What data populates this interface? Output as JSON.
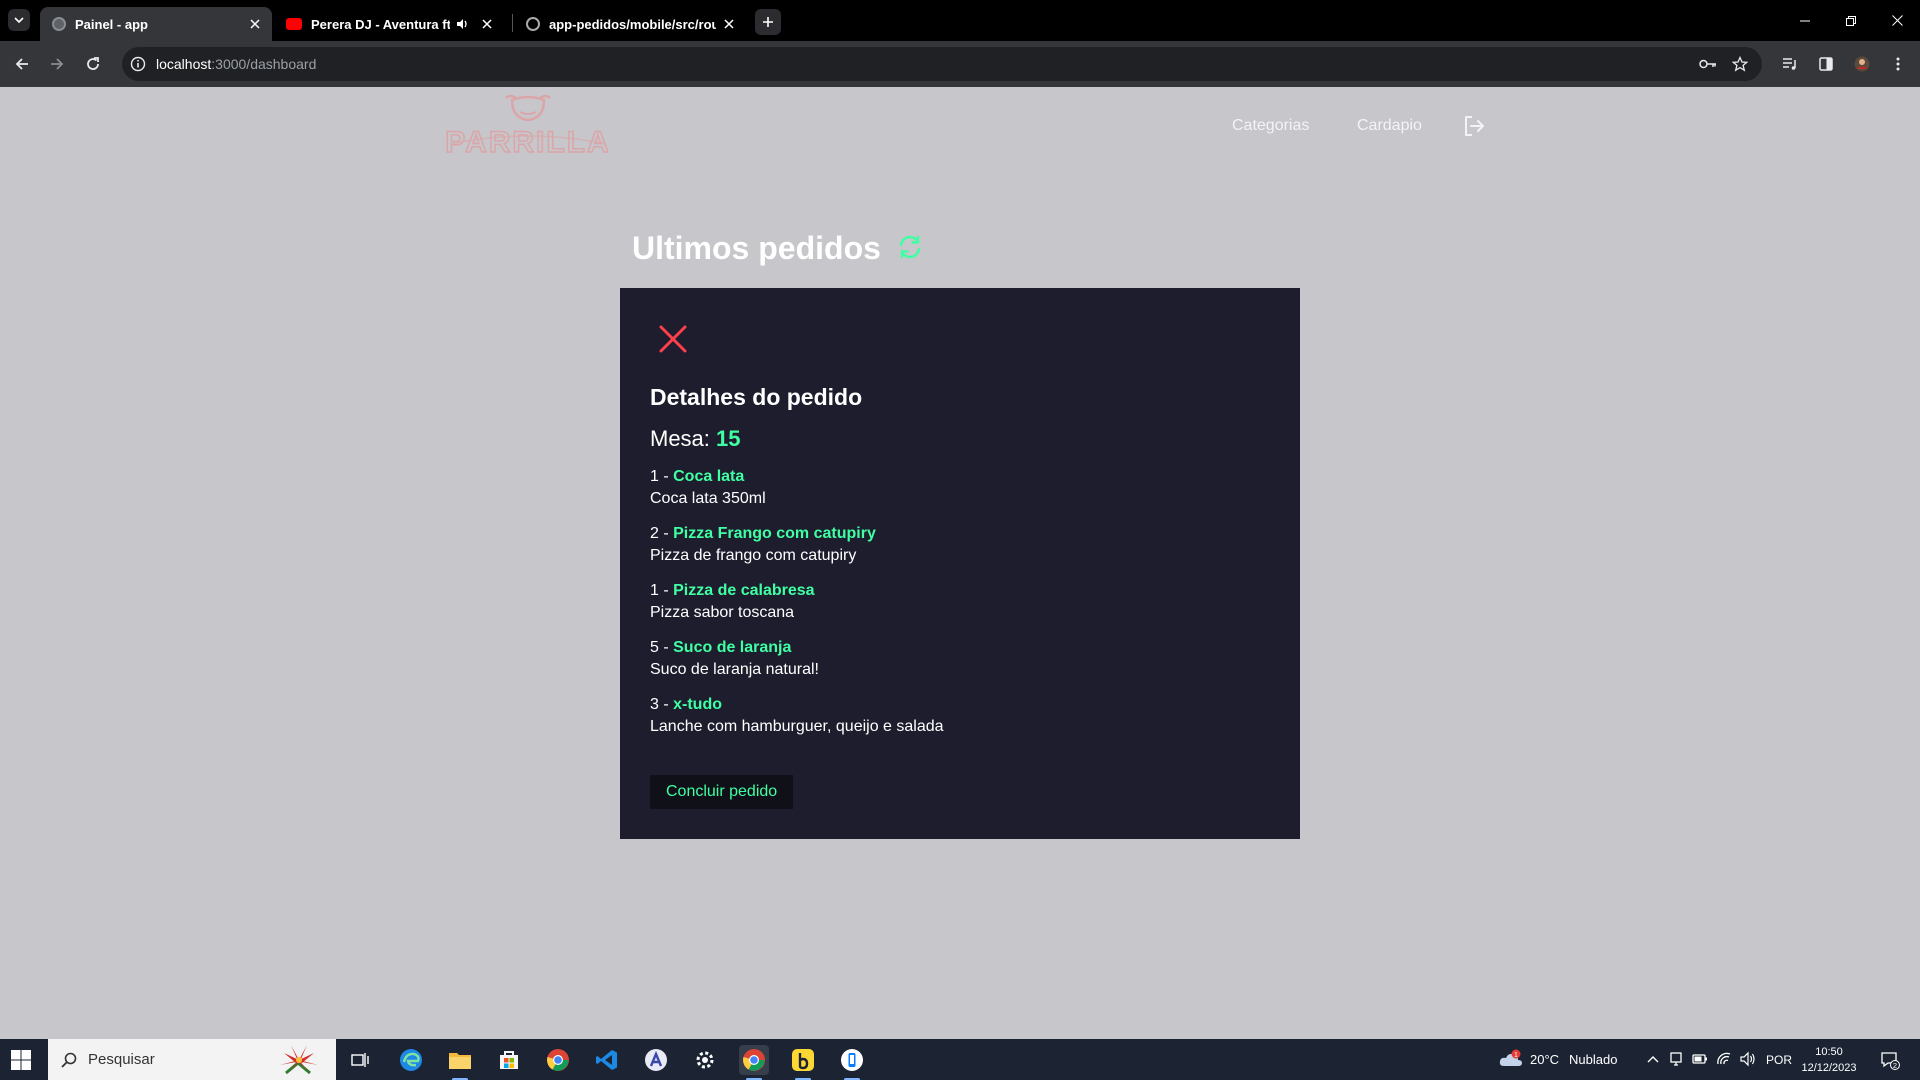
{
  "browser": {
    "tabs": [
      {
        "title": "Painel - app",
        "active": true
      },
      {
        "title": "Perera DJ - Aventura ft MC",
        "active": false
      },
      {
        "title": "app-pedidos/mobile/src/route",
        "active": false
      }
    ],
    "url": {
      "host": "localhost",
      "rest": ":3000/dashboard"
    }
  },
  "header": {
    "logo_text": "PARRILLA",
    "nav": [
      {
        "label": "Categorias"
      },
      {
        "label": "Cardapio"
      }
    ]
  },
  "dashboard": {
    "title": "Ultimos pedidos"
  },
  "modal": {
    "title": "Detalhes do pedido",
    "table_label": "Mesa:",
    "table_number": "15",
    "items": [
      {
        "qty": "1 - ",
        "name": "Coca lata",
        "desc": "Coca lata 350ml"
      },
      {
        "qty": "2 - ",
        "name": "Pizza Frango com catupiry",
        "desc": "Pizza de frango com catupiry"
      },
      {
        "qty": "1 - ",
        "name": "Pizza de calabresa",
        "desc": "Pizza sabor toscana"
      },
      {
        "qty": "5 - ",
        "name": "Suco de laranja",
        "desc": "Suco de laranja natural!"
      },
      {
        "qty": "3 - ",
        "name": "x-tudo",
        "desc": "Lanche com hamburguer, queijo e salada"
      }
    ],
    "finish_label": "Concluir pedido"
  },
  "taskbar": {
    "search_placeholder": "Pesquisar",
    "weather": {
      "temp": "20°C",
      "condition": "Nublado",
      "alert_count": "1"
    },
    "language": "POR",
    "time": "10:50",
    "date": "12/12/2023",
    "notifications": "2"
  },
  "colors": {
    "accent": "#3fffa3",
    "danger": "#ff3f4b",
    "modal_bg": "#1d1d2e",
    "page_bg": "#c6c6cb"
  }
}
